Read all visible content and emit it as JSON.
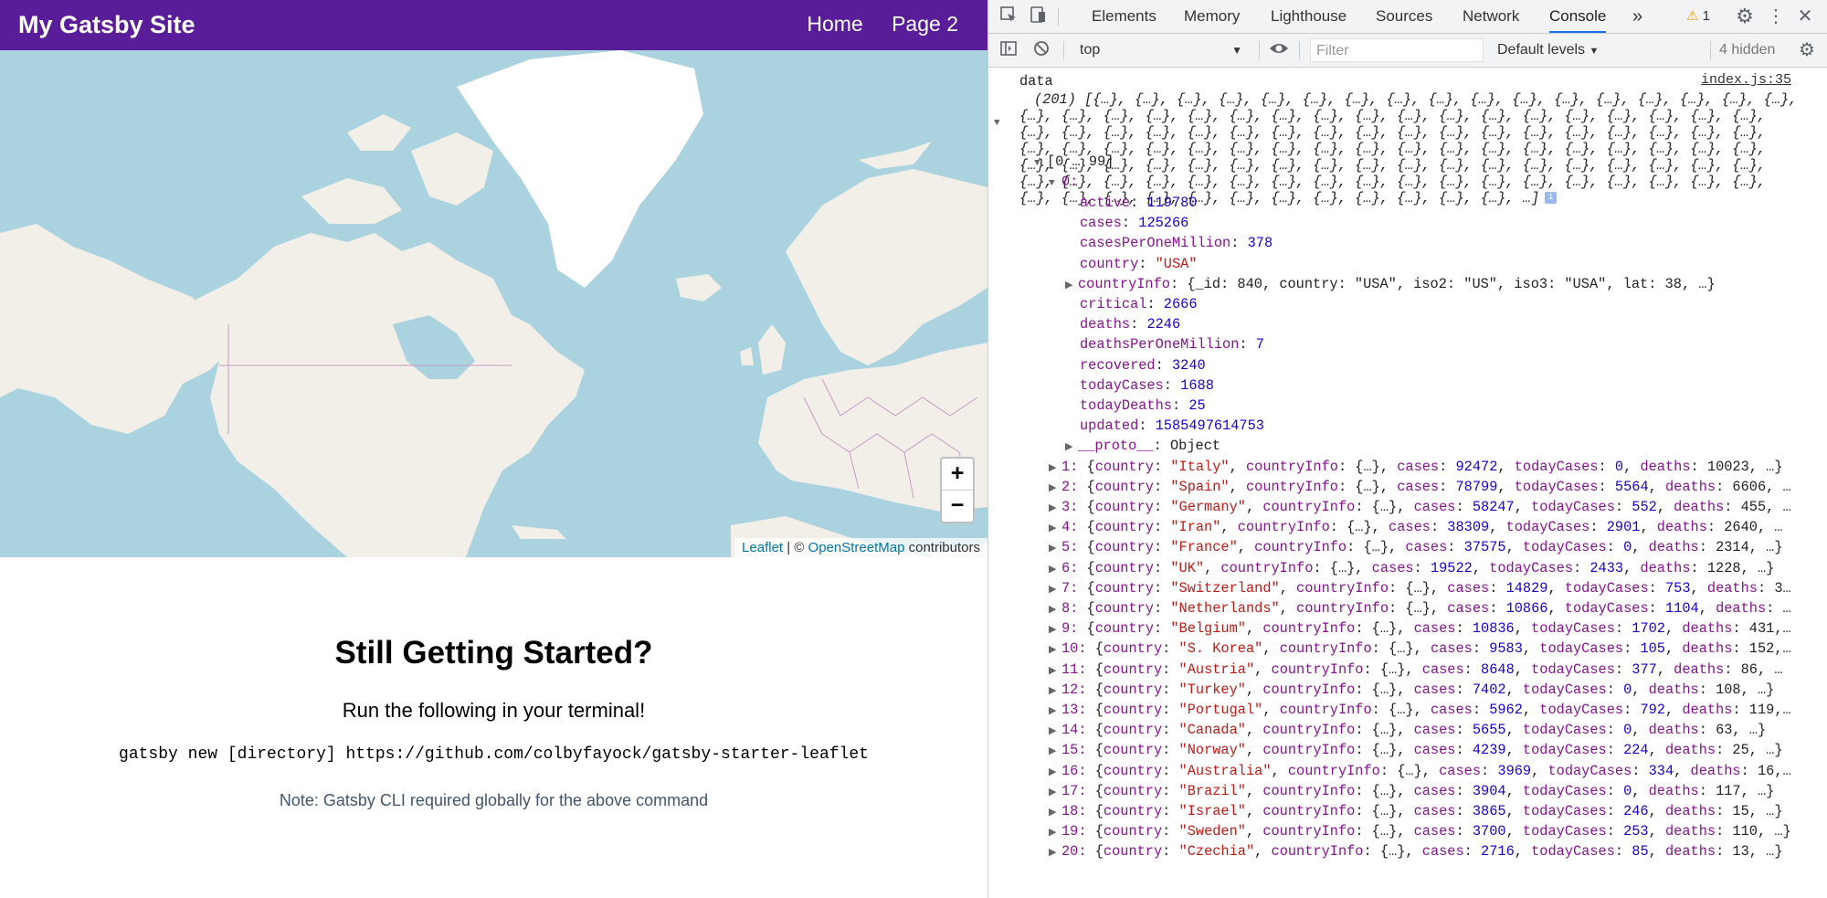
{
  "site": {
    "title": "My Gatsby Site",
    "nav": [
      "Home",
      "Page 2"
    ]
  },
  "map": {
    "zoom_in": "+",
    "zoom_out": "−",
    "attribution": {
      "leaflet": "Leaflet",
      "sep": " | © ",
      "osm": "OpenStreetMap",
      "suffix": " contributors"
    }
  },
  "content": {
    "heading": "Still Getting Started?",
    "lead": "Run the following in your terminal!",
    "command": "gatsby new [directory] https://github.com/colbyfayock/gatsby-starter-leaflet",
    "note": "Note: Gatsby CLI required globally for the above command"
  },
  "devtools": {
    "tabs": [
      "Elements",
      "Memory",
      "Lighthouse",
      "Sources",
      "Network",
      "Console"
    ],
    "active_tab": "Console",
    "more_tabs": "»",
    "warning_count": "1",
    "context": "top",
    "filter_placeholder": "Filter",
    "levels": "Default levels",
    "hidden": "4 hidden"
  },
  "console": {
    "label": "data",
    "source": "index.js:35",
    "summary_lines": [
      "(201) [{…}, {…}, {…}, {…}, {…}, {…}, {…}, {…}, {…}, {…}, {…}, {…}, {…}, {…}, {…}, {…}, {…},",
      "{…}, {…}, {…}, {…}, {…}, {…}, {…}, {…}, {…}, {…}, {…}, {…}, {…}, {…}, {…}, {…}, {…}, {…},",
      "{…}, {…}, {…}, {…}, {…}, {…}, {…}, {…}, {…}, {…}, {…}, {…}, {…}, {…}, {…}, {…}, {…}, {…},",
      "{…}, {…}, {…}, {…}, {…}, {…}, {…}, {…}, {…}, {…}, {…}, {…}, {…}, {…}, {…}, {…}, {…}, {…},",
      "{…}, {…}, {…}, {…}, {…}, {…}, {…}, {…}, {…}, {…}, {…}, {…}, {…}, {…}, {…}, {…}, {…}, {…},",
      "{…}, {…}, {…}, {…}, {…}, {…}, {…}, {…}, {…}, {…}, {…}, {…}, {…}, {…}, {…}, {…}, {…}, {…},"
    ],
    "summary_last": "{…}, {…}, {…}, {…}, {…}, {…}, {…}, {…}, {…}, {…}, {…}, {…}, …]",
    "range": "[0 … 99]",
    "item0_label": "0:",
    "item0": [
      {
        "key": "active",
        "val": "119780",
        "t": "n"
      },
      {
        "key": "cases",
        "val": "125266",
        "t": "n"
      },
      {
        "key": "casesPerOneMillion",
        "val": "378",
        "t": "n"
      },
      {
        "key": "country",
        "val": "\"USA\"",
        "t": "s"
      },
      {
        "key": "countryInfo",
        "val": "{_id: 840, country: \"USA\", iso2: \"US\", iso3: \"USA\", lat: 38, …}",
        "t": "o"
      },
      {
        "key": "critical",
        "val": "2666",
        "t": "n"
      },
      {
        "key": "deaths",
        "val": "2246",
        "t": "n"
      },
      {
        "key": "deathsPerOneMillion",
        "val": "7",
        "t": "n"
      },
      {
        "key": "recovered",
        "val": "3240",
        "t": "n"
      },
      {
        "key": "todayCases",
        "val": "1688",
        "t": "n"
      },
      {
        "key": "todayDeaths",
        "val": "25",
        "t": "n"
      },
      {
        "key": "updated",
        "val": "1585497614753",
        "t": "n"
      },
      {
        "key": "__proto__",
        "val": "Object",
        "t": "o"
      }
    ],
    "rows": [
      {
        "i": "1",
        "country": "\"Italy\"",
        "cases": "92472",
        "today": "0",
        "deaths": "10023, …}"
      },
      {
        "i": "2",
        "country": "\"Spain\"",
        "cases": "78799",
        "today": "5564",
        "deaths": "6606, …"
      },
      {
        "i": "3",
        "country": "\"Germany\"",
        "cases": "58247",
        "today": "552",
        "deaths": "455, …"
      },
      {
        "i": "4",
        "country": "\"Iran\"",
        "cases": "38309",
        "today": "2901",
        "deaths": "2640, …"
      },
      {
        "i": "5",
        "country": "\"France\"",
        "cases": "37575",
        "today": "0",
        "deaths": "2314, …}"
      },
      {
        "i": "6",
        "country": "\"UK\"",
        "cases": "19522",
        "today": "2433",
        "deaths": "1228, …}"
      },
      {
        "i": "7",
        "country": "\"Switzerland\"",
        "cases": "14829",
        "today": "753",
        "deaths": "3…"
      },
      {
        "i": "8",
        "country": "\"Netherlands\"",
        "cases": "10866",
        "today": "1104",
        "deaths": "…"
      },
      {
        "i": "9",
        "country": "\"Belgium\"",
        "cases": "10836",
        "today": "1702",
        "deaths": "431,…"
      },
      {
        "i": "10",
        "country": "\"S. Korea\"",
        "cases": "9583",
        "today": "105",
        "deaths": "152,…"
      },
      {
        "i": "11",
        "country": "\"Austria\"",
        "cases": "8648",
        "today": "377",
        "deaths": "86, …"
      },
      {
        "i": "12",
        "country": "\"Turkey\"",
        "cases": "7402",
        "today": "0",
        "deaths": "108, …}"
      },
      {
        "i": "13",
        "country": "\"Portugal\"",
        "cases": "5962",
        "today": "792",
        "deaths": "119,…"
      },
      {
        "i": "14",
        "country": "\"Canada\"",
        "cases": "5655",
        "today": "0",
        "deaths": "63, …}"
      },
      {
        "i": "15",
        "country": "\"Norway\"",
        "cases": "4239",
        "today": "224",
        "deaths": "25, …}"
      },
      {
        "i": "16",
        "country": "\"Australia\"",
        "cases": "3969",
        "today": "334",
        "deaths": "16,…"
      },
      {
        "i": "17",
        "country": "\"Brazil\"",
        "cases": "3904",
        "today": "0",
        "deaths": "117, …}"
      },
      {
        "i": "18",
        "country": "\"Israel\"",
        "cases": "3865",
        "today": "246",
        "deaths": "15, …}"
      },
      {
        "i": "19",
        "country": "\"Sweden\"",
        "cases": "3700",
        "today": "253",
        "deaths": "110, …}"
      },
      {
        "i": "20",
        "country": "\"Czechia\"",
        "cases": "2716",
        "today": "85",
        "deaths": "13, …}"
      }
    ]
  },
  "colors": {
    "header_purple": "#5a1d9a",
    "ocean": "#aad3df",
    "land": "#f2efe9",
    "ice": "#ffffff",
    "devtools_accent": "#1a73e8",
    "key_purple": "#881391",
    "number_blue": "#1c00cf",
    "string_red": "#c41a16"
  }
}
